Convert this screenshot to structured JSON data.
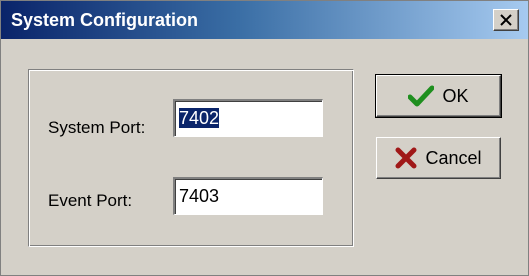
{
  "window": {
    "title": "System Configuration",
    "close_label": "×"
  },
  "form": {
    "system_port_label": "System Port:",
    "system_port_value": "7402",
    "event_port_label": "Event Port:",
    "event_port_value": "7403"
  },
  "buttons": {
    "ok_label": "OK",
    "cancel_label": "Cancel"
  },
  "colors": {
    "ok_icon": "#1f8f1f",
    "cancel_icon": "#a01818",
    "title_bar_start": "#0a246a"
  },
  "icons": {
    "ok": "check-icon",
    "cancel": "x-icon",
    "close": "close-icon"
  }
}
